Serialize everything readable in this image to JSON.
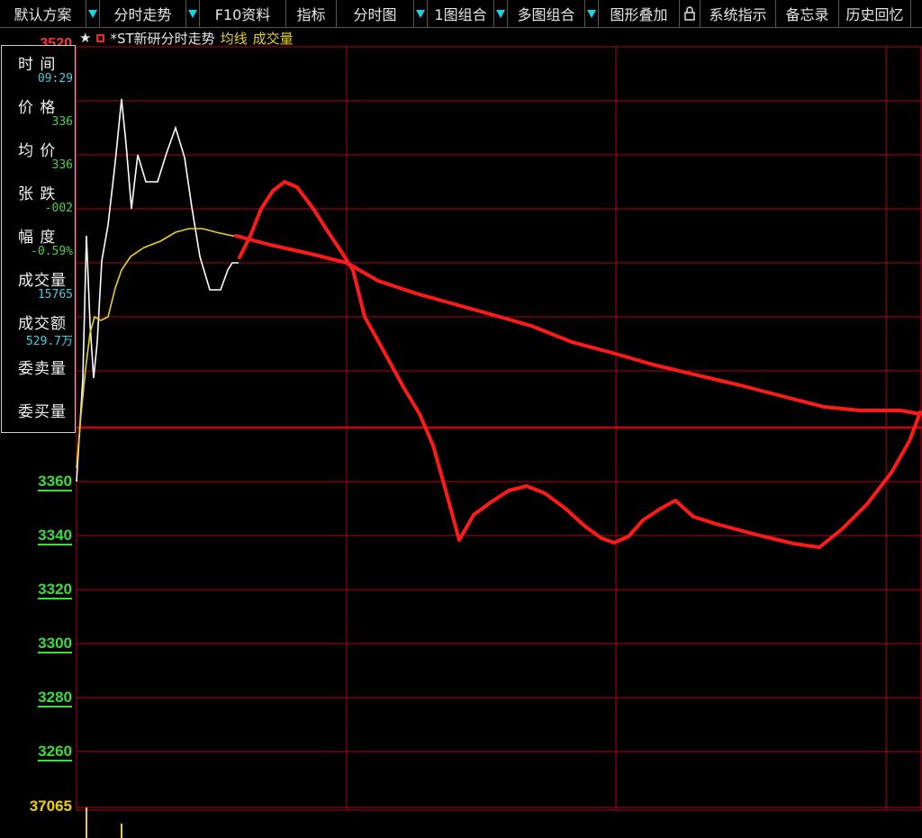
{
  "toolbar": {
    "items": [
      {
        "label": "默认方案",
        "arrow": true
      },
      {
        "label": "分时走势",
        "arrow": true
      },
      {
        "label": "F10资料",
        "arrow": false
      },
      {
        "label": "指标",
        "arrow": false
      },
      {
        "label": "分时图",
        "arrow": true
      },
      {
        "label": "1图组合",
        "arrow": true
      },
      {
        "label": "多图组合",
        "arrow": true
      },
      {
        "label": "图形叠加",
        "arrow": false,
        "lock": true
      },
      {
        "label": "系统指示",
        "arrow": false
      },
      {
        "label": "备忘录",
        "arrow": false
      },
      {
        "label": "历史回忆",
        "arrow": false
      }
    ]
  },
  "chart_header": {
    "stock_name": "*ST新研分时走势",
    "avg_line_label": "均线",
    "volume_label": "成交量",
    "top_price_partial": "3520"
  },
  "info_panel": {
    "time_label": "时 间",
    "time_value": "09:29",
    "price_label": "价 格",
    "price_value": "336",
    "avg_label": "均 价",
    "avg_value": "336",
    "change_label": "张 跌",
    "change_value": "-002",
    "amplitude_label": "幅 度",
    "amplitude_value": "-0.59%",
    "volume_label": "成交量",
    "volume_value": "15765",
    "turnover_label": "成交额",
    "turnover_value": "529.7万",
    "ask_volume_label": "委卖量",
    "bid_volume_label": "委买量"
  },
  "y_axis": {
    "ticks": [
      "3360",
      "3340",
      "3320",
      "3300",
      "3280",
      "3260"
    ],
    "volume_max": "37065"
  },
  "colors": {
    "grid": "#b0001a",
    "price_line": "#ffffff",
    "avg_line": "#e6d21e",
    "annotation": "#ff1a1a",
    "tick_text": "#3bdc3b",
    "volume_text": "#f0d000",
    "accent": "#12d6e6"
  }
}
